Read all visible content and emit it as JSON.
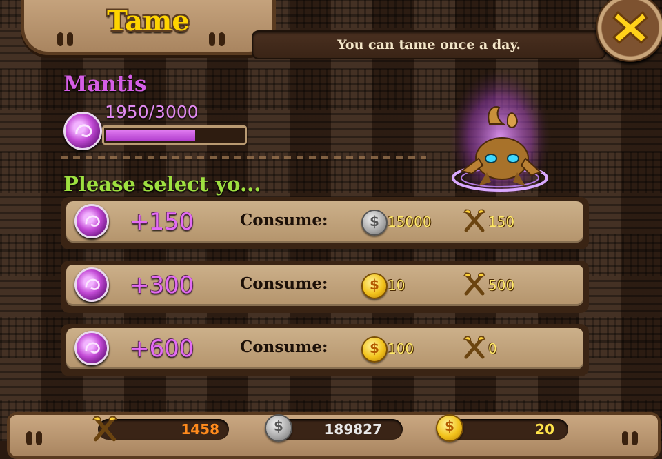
{
  "header": {
    "title": "Tame",
    "notice": "You can tame once a day."
  },
  "close_button": {
    "icon": "close-icon"
  },
  "pet": {
    "name": "Mantis",
    "progress_text": "1950/3000",
    "progress_current": 1950,
    "progress_max": 3000
  },
  "prompt": "Please select yo...",
  "options": [
    {
      "amount": "+150",
      "consume_label": "Consume:",
      "coin_type": "silver",
      "cost1": "15000",
      "cost2": "150"
    },
    {
      "amount": "+300",
      "consume_label": "Consume:",
      "coin_type": "gold",
      "cost1": "10",
      "cost2": "500"
    },
    {
      "amount": "+600",
      "consume_label": "Consume:",
      "coin_type": "gold",
      "cost1": "100",
      "cost2": "0"
    }
  ],
  "resources": {
    "axes": "1458",
    "silver": "189827",
    "gold": "20"
  },
  "colors": {
    "title": "#ffd400",
    "pet_name": "#d55ee6",
    "prompt": "#9ee040",
    "amount": "#e36cf4",
    "progress_fill": "#c84fdc",
    "axes_value": "#ff8a1c",
    "silver_value": "#e8e8e8",
    "gold_value": "#ffe44a"
  }
}
